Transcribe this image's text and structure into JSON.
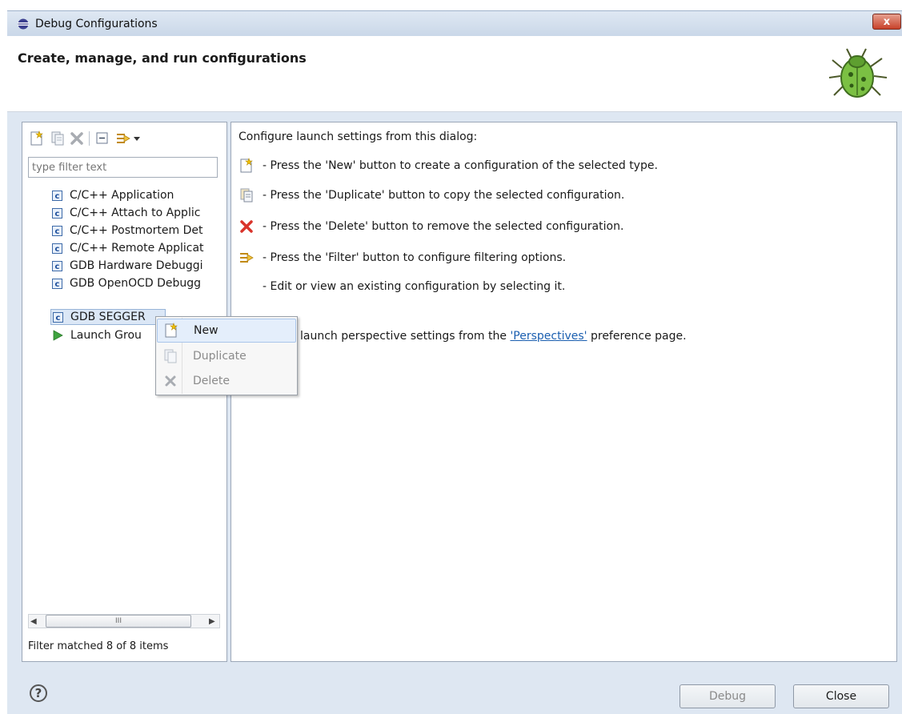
{
  "window": {
    "title": "Debug Configurations",
    "close_glyph": "x"
  },
  "header": {
    "title": "Create, manage, and run configurations",
    "icon": "bug-icon"
  },
  "left_panel": {
    "toolbar": [
      "new-config-icon",
      "duplicate-icon",
      "delete-icon",
      "collapse-all-icon",
      "filter-icon",
      "dropdown-arrow-icon"
    ],
    "filter_placeholder": "type filter text",
    "tree_items": [
      {
        "label": "C/C++ Application",
        "icon": "c-icon"
      },
      {
        "label": "C/C++ Attach to Applic",
        "icon": "c-icon"
      },
      {
        "label": "C/C++ Postmortem Det",
        "icon": "c-icon"
      },
      {
        "label": "C/C++ Remote Applicat",
        "icon": "c-icon"
      },
      {
        "label": "GDB Hardware Debuggi",
        "icon": "c-icon"
      },
      {
        "label": "GDB OpenOCD Debugg",
        "icon": "c-icon"
      },
      {
        "label": "GDB SEGGER",
        "icon": "c-icon",
        "selected": true
      },
      {
        "label": "Launch Grou",
        "icon": "launch-group-icon"
      }
    ],
    "scrollbar_thumb": "III",
    "status": "Filter matched 8 of 8 items"
  },
  "right_panel": {
    "intro": "Configure launch settings from this dialog:",
    "instructions": [
      {
        "icon": "new-config-icon",
        "text": "- Press the 'New' button to create a configuration of the selected type."
      },
      {
        "icon": "duplicate-icon",
        "text": "- Press the 'Duplicate' button to copy the selected configuration."
      },
      {
        "icon": "delete-icon",
        "text": "- Press the 'Delete' button to remove the selected configuration."
      },
      {
        "icon": "filter-icon",
        "text": "- Press the 'Filter' button to configure filtering options."
      },
      {
        "icon": null,
        "text": "- Edit or view an existing configuration by selecting it."
      }
    ],
    "perspective_prefix": "launch perspective settings from the",
    "perspective_link": "'Perspectives'",
    "perspective_suffix": "preference page."
  },
  "context_menu": {
    "items": [
      {
        "label": "New",
        "icon": "new-config-icon",
        "enabled": true,
        "highlighted": true
      },
      {
        "label": "Duplicate",
        "icon": "duplicate-icon",
        "enabled": false
      },
      {
        "label": "Delete",
        "icon": "delete-icon",
        "enabled": false
      }
    ]
  },
  "footer": {
    "help_glyph": "?",
    "debug_label": "Debug",
    "close_label": "Close"
  },
  "colors": {
    "body_background": "#dee7f2",
    "delete_red": "#d9342b",
    "link_blue": "#1b5fb0"
  }
}
